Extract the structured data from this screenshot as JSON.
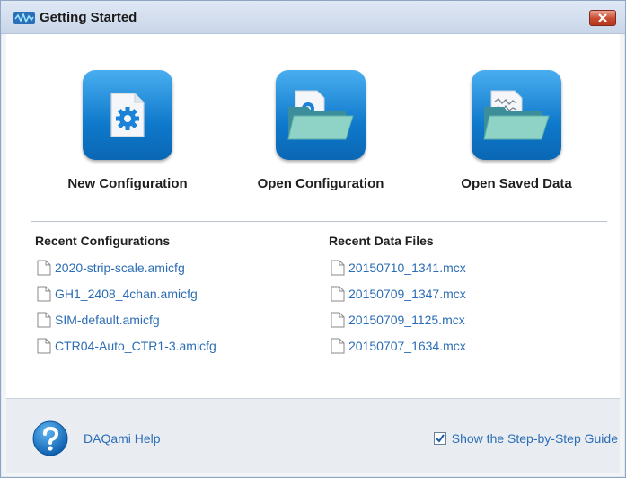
{
  "window": {
    "title": "Getting Started"
  },
  "actions": [
    {
      "label": "New Configuration",
      "icon": "new-config-icon"
    },
    {
      "label": "Open Configuration",
      "icon": "open-folder-icon"
    },
    {
      "label": "Open Saved Data",
      "icon": "open-data-folder-icon"
    }
  ],
  "recent_configurations": {
    "title": "Recent Configurations",
    "items": [
      "2020-strip-scale.amicfg",
      "GH1_2408_4chan.amicfg",
      "SIM-default.amicfg",
      "CTR04-Auto_CTR1-3.amicfg"
    ]
  },
  "recent_data_files": {
    "title": "Recent Data Files",
    "items": [
      "20150710_1341.mcx",
      "20150709_1347.mcx",
      "20150709_1125.mcx",
      "20150707_1634.mcx"
    ]
  },
  "footer": {
    "help_label": "DAQami Help",
    "guide_label": "Show the Step-by-Step Guide",
    "guide_checked": true
  },
  "colors": {
    "accent": "#1480d6",
    "link": "#2c6db5",
    "close": "#c8492f"
  }
}
